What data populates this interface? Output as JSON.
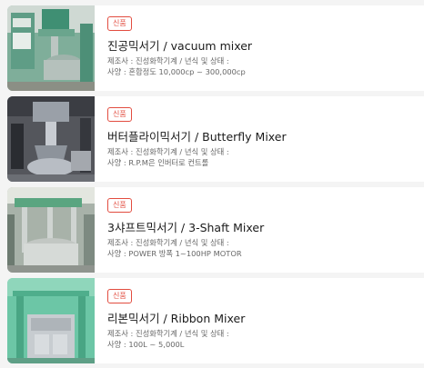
{
  "products": [
    {
      "badge": "신품",
      "title": "진공믹서기 / vacuum mixer",
      "maker": "제조사 : 진성화학기계 / 년식 및 상태 :",
      "spec": "사양 : 혼합정도 10,000cp ~ 300,000cp",
      "image": "vacuum-mixer-photo"
    },
    {
      "badge": "신품",
      "title": "버터플라이믹서기 / Butterfly Mixer",
      "maker": "제조사 : 진성화학기계 / 년식 및 상태 :",
      "spec": "사양 : R.P.M은 인버터로 컨트롤",
      "image": "butterfly-mixer-photo"
    },
    {
      "badge": "신품",
      "title": "3샤프트믹서기 / 3-Shaft Mixer",
      "maker": "제조사 : 진성화학기계 / 년식 및 상태 :",
      "spec": "사양 : POWER 방폭 1~100HP MOTOR",
      "image": "3-shaft-mixer-photo"
    },
    {
      "badge": "신품",
      "title": "리본믹서기 / Ribbon Mixer",
      "maker": "제조사 : 진성화학기계 / 년식 및 상태 :",
      "spec": "사양 : 100L ~ 5,000L",
      "image": "ribbon-mixer-photo"
    }
  ],
  "colors": {
    "background": "#f4f4f4",
    "card": "#ffffff",
    "badge": "#e24c3f",
    "title": "#1a1a1a",
    "meta": "#666666"
  }
}
